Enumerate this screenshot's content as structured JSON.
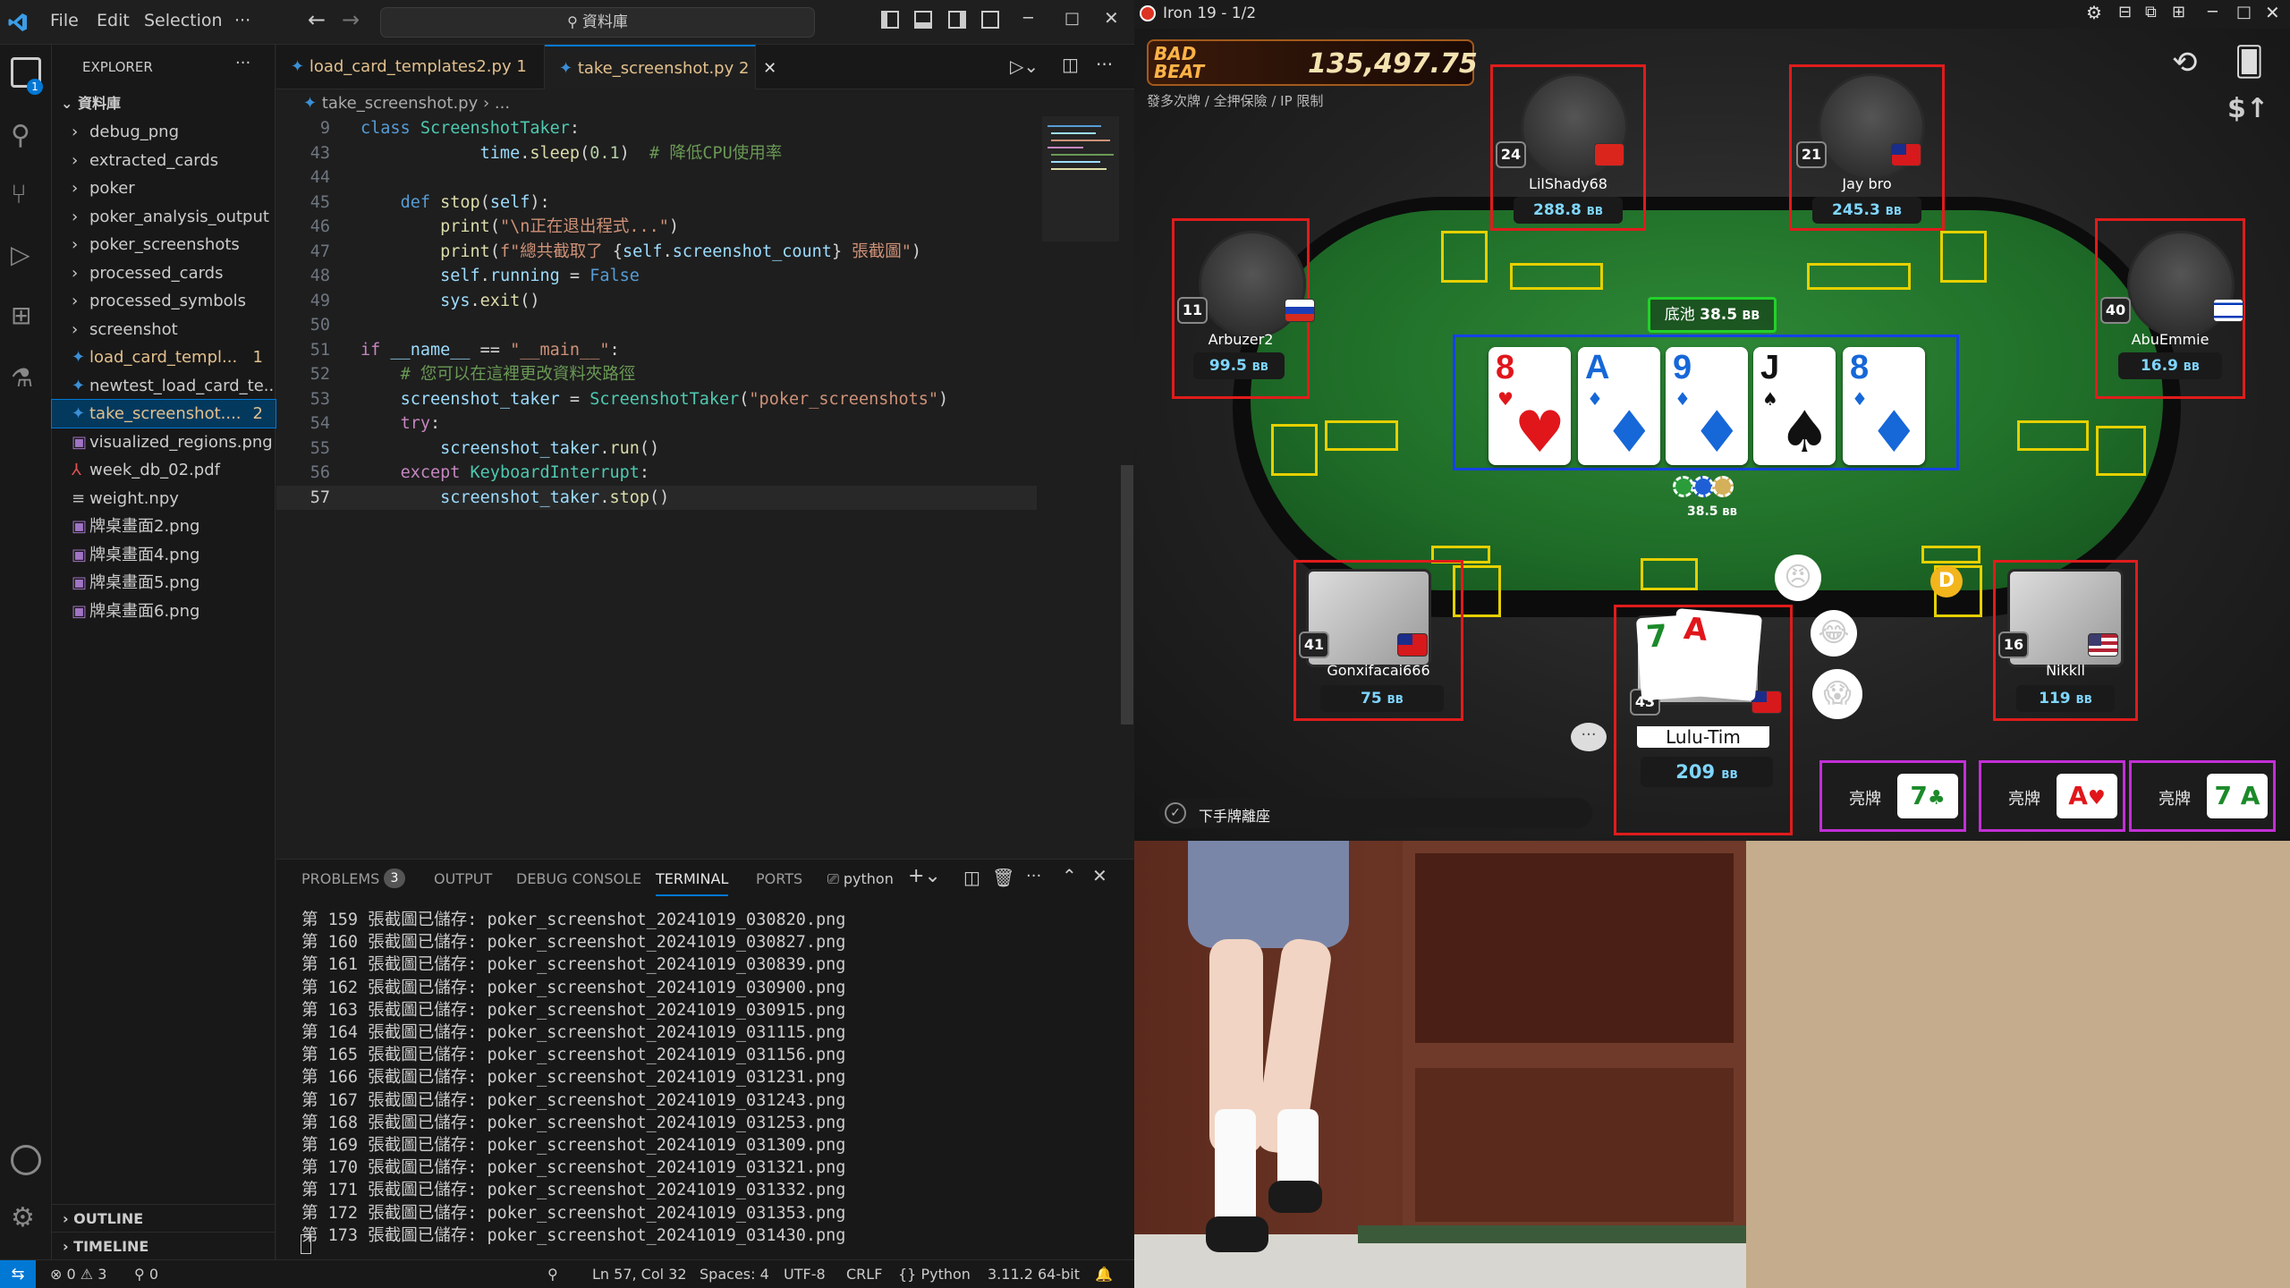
{
  "vscode": {
    "menu": [
      "File",
      "Edit",
      "Selection",
      "···"
    ],
    "command_center": "資料庫",
    "explorer": {
      "title": "EXPLORER",
      "root": "資料庫",
      "items": [
        {
          "label": "debug_png",
          "type": "folder"
        },
        {
          "label": "extracted_cards",
          "type": "folder"
        },
        {
          "label": "poker",
          "type": "folder"
        },
        {
          "label": "poker_analysis_output",
          "type": "folder"
        },
        {
          "label": "poker_screenshots",
          "type": "folder"
        },
        {
          "label": "processed_cards",
          "type": "folder"
        },
        {
          "label": "processed_symbols",
          "type": "folder"
        },
        {
          "label": "screenshot",
          "type": "folder"
        },
        {
          "label": "load_card_templ...",
          "type": "py",
          "badge": "1",
          "color": "#e2c08d"
        },
        {
          "label": "newtest_load_card_te...",
          "type": "py"
        },
        {
          "label": "take_screenshot....",
          "type": "py",
          "badge": "2",
          "color": "#e2c08d",
          "selected": true
        },
        {
          "label": "visualized_regions.png",
          "type": "png"
        },
        {
          "label": "week_db_02.pdf",
          "type": "pdf"
        },
        {
          "label": "weight.npy",
          "type": "npy"
        },
        {
          "label": "牌桌畫面2.png",
          "type": "png"
        },
        {
          "label": "牌桌畫面4.png",
          "type": "png"
        },
        {
          "label": "牌桌畫面5.png",
          "type": "png"
        },
        {
          "label": "牌桌畫面6.png",
          "type": "png"
        }
      ],
      "outline": "OUTLINE",
      "timeline": "TIMELINE"
    },
    "tabs": [
      {
        "label": "load_card_templates2.py",
        "badge": "1",
        "modified": true,
        "active": false
      },
      {
        "label": "take_screenshot.py",
        "badge": "2",
        "active": true
      }
    ],
    "breadcrumb": {
      "file": "take_screenshot.py",
      "rest": "..."
    },
    "code_lines": [
      {
        "n": "9",
        "tokens": [
          [
            "k",
            "class "
          ],
          [
            "cls",
            "ScreenshotTaker"
          ],
          [
            "t",
            ":"
          ]
        ]
      },
      {
        "n": "43",
        "tokens": [
          [
            "t",
            "            "
          ],
          [
            "v",
            "time"
          ],
          [
            "t",
            "."
          ],
          [
            "f",
            "sleep"
          ],
          [
            "t",
            "("
          ],
          [
            "num",
            "0.1"
          ],
          [
            "t",
            ")  "
          ],
          [
            "c",
            "# 降低CPU使用率"
          ]
        ]
      },
      {
        "n": "44",
        "tokens": []
      },
      {
        "n": "45",
        "tokens": [
          [
            "t",
            "    "
          ],
          [
            "k",
            "def "
          ],
          [
            "f",
            "stop"
          ],
          [
            "t",
            "("
          ],
          [
            "v",
            "self"
          ],
          [
            "t",
            "):"
          ]
        ]
      },
      {
        "n": "46",
        "tokens": [
          [
            "t",
            "        "
          ],
          [
            "f",
            "print"
          ],
          [
            "t",
            "("
          ],
          [
            "s",
            "\"\\n正在退出程式...\""
          ],
          [
            "t",
            ")"
          ]
        ]
      },
      {
        "n": "47",
        "tokens": [
          [
            "t",
            "        "
          ],
          [
            "f",
            "print"
          ],
          [
            "t",
            "("
          ],
          [
            "s",
            "f\"總共截取了 "
          ],
          [
            "t",
            "{"
          ],
          [
            "v",
            "self"
          ],
          [
            "t",
            "."
          ],
          [
            "v",
            "screenshot_count"
          ],
          [
            "t",
            "}"
          ],
          [
            "s",
            " 張截圖\""
          ],
          [
            "t",
            ")"
          ]
        ]
      },
      {
        "n": "48",
        "tokens": [
          [
            "t",
            "        "
          ],
          [
            "v",
            "self"
          ],
          [
            "t",
            "."
          ],
          [
            "v",
            "running"
          ],
          [
            "t",
            " = "
          ],
          [
            "k",
            "False"
          ]
        ]
      },
      {
        "n": "49",
        "tokens": [
          [
            "t",
            "        "
          ],
          [
            "v",
            "sys"
          ],
          [
            "t",
            "."
          ],
          [
            "f",
            "exit"
          ],
          [
            "t",
            "()"
          ]
        ]
      },
      {
        "n": "50",
        "tokens": []
      },
      {
        "n": "51",
        "tokens": [
          [
            "kw",
            "if "
          ],
          [
            "v",
            "__name__"
          ],
          [
            "t",
            " == "
          ],
          [
            "s",
            "\"__main__\""
          ],
          [
            "t",
            ":"
          ]
        ]
      },
      {
        "n": "52",
        "tokens": [
          [
            "t",
            "    "
          ],
          [
            "c",
            "# 您可以在這裡更改資料夾路徑"
          ]
        ]
      },
      {
        "n": "53",
        "tokens": [
          [
            "t",
            "    "
          ],
          [
            "v",
            "screenshot_taker"
          ],
          [
            "t",
            " = "
          ],
          [
            "cls",
            "ScreenshotTaker"
          ],
          [
            "t",
            "("
          ],
          [
            "s",
            "\"poker_screenshots\""
          ],
          [
            "t",
            ")"
          ]
        ]
      },
      {
        "n": "54",
        "tokens": [
          [
            "t",
            "    "
          ],
          [
            "kw",
            "try"
          ],
          [
            "t",
            ":"
          ]
        ]
      },
      {
        "n": "55",
        "tokens": [
          [
            "t",
            "        "
          ],
          [
            "v",
            "screenshot_taker"
          ],
          [
            "t",
            "."
          ],
          [
            "f",
            "run"
          ],
          [
            "t",
            "()"
          ]
        ]
      },
      {
        "n": "56",
        "tokens": [
          [
            "t",
            "    "
          ],
          [
            "kw",
            "except "
          ],
          [
            "cls",
            "KeyboardInterrupt"
          ],
          [
            "t",
            ":"
          ]
        ]
      },
      {
        "n": "57",
        "tokens": [
          [
            "t",
            "        "
          ],
          [
            "v",
            "screenshot_taker"
          ],
          [
            "t",
            "."
          ],
          [
            "f",
            "stop"
          ],
          [
            "t",
            "()"
          ]
        ]
      }
    ],
    "panel_tabs": {
      "problems": "PROBLEMS",
      "problems_count": "3",
      "output": "OUTPUT",
      "debug": "DEBUG CONSOLE",
      "terminal": "TERMINAL",
      "ports": "PORTS",
      "shell": "python"
    },
    "terminal_lines": [
      "第 159 張截圖已儲存: poker_screenshot_20241019_030820.png",
      "第 160 張截圖已儲存: poker_screenshot_20241019_030827.png",
      "第 161 張截圖已儲存: poker_screenshot_20241019_030839.png",
      "第 162 張截圖已儲存: poker_screenshot_20241019_030900.png",
      "第 163 張截圖已儲存: poker_screenshot_20241019_030915.png",
      "第 164 張截圖已儲存: poker_screenshot_20241019_031115.png",
      "第 165 張截圖已儲存: poker_screenshot_20241019_031156.png",
      "第 166 張截圖已儲存: poker_screenshot_20241019_031231.png",
      "第 167 張截圖已儲存: poker_screenshot_20241019_031243.png",
      "第 168 張截圖已儲存: poker_screenshot_20241019_031253.png",
      "第 169 張截圖已儲存: poker_screenshot_20241019_031309.png",
      "第 170 張截圖已儲存: poker_screenshot_20241019_031321.png",
      "第 171 張截圖已儲存: poker_screenshot_20241019_031332.png",
      "第 172 張截圖已儲存: poker_screenshot_20241019_031353.png",
      "第 173 張截圖已儲存: poker_screenshot_20241019_031430.png"
    ],
    "status": {
      "errors": "0",
      "warnings": "3",
      "ports": "0",
      "position": "Ln 57, Col 32",
      "spaces": "Spaces: 4",
      "encoding": "UTF-8",
      "eol": "CRLF",
      "language": "Python",
      "interpreter": "3.11.2 64-bit"
    }
  },
  "poker": {
    "window_title": "Iron 19 - 1/2",
    "bad_beat_label": "BAD BEAT",
    "jackpot": "135,497.75",
    "table_info": "發多次牌 / 全押保險 / IP 限制",
    "pot_label": "底池",
    "pot_value": "38.5",
    "bb_unit": "BB",
    "chips_value": "38.5",
    "sit_out_label": "下手牌離座",
    "players": [
      {
        "name": "LilShady68",
        "level": "24",
        "stack": "288.8",
        "flag": "VN"
      },
      {
        "name": "Jay bro",
        "level": "21",
        "stack": "245.3",
        "flag": "TW"
      },
      {
        "name": "Arbuzer2",
        "level": "11",
        "stack": "99.5",
        "flag": "RU"
      },
      {
        "name": "AbuEmmie",
        "level": "40",
        "stack": "16.9",
        "flag": "IL"
      },
      {
        "name": "Gonxifacai666",
        "level": "41",
        "stack": "75",
        "flag": "TW"
      },
      {
        "name": "Nikkll",
        "level": "16",
        "stack": "119",
        "flag": "US"
      },
      {
        "name": "Lulu-Tim",
        "level": "43",
        "stack": "209",
        "flag": "TW",
        "hero": true
      }
    ],
    "board": [
      {
        "rank": "8",
        "suit": "♥",
        "color": "red"
      },
      {
        "rank": "A",
        "suit": "♦",
        "color": "blue"
      },
      {
        "rank": "9",
        "suit": "♦",
        "color": "blue"
      },
      {
        "rank": "J",
        "suit": "♠",
        "color": "black"
      },
      {
        "rank": "8",
        "suit": "♦",
        "color": "blue"
      }
    ],
    "hero_cards": [
      {
        "rank": "7"
      },
      {
        "rank": "A"
      }
    ],
    "show_buttons": [
      {
        "label": "亮牌",
        "card": "7",
        "suit": "♣",
        "color": "#1b8a2a"
      },
      {
        "label": "亮牌",
        "card": "A",
        "suit": "♥",
        "color": "#e0161b"
      },
      {
        "label": "亮牌",
        "card": "7 A",
        "suit": "",
        "color": "#1b8a2a"
      }
    ],
    "dealer_label": "D"
  }
}
